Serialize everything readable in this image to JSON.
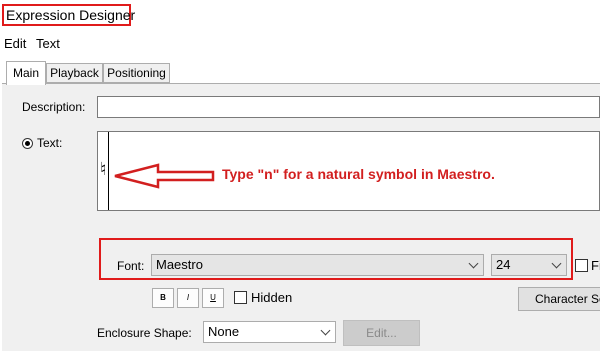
{
  "window": {
    "title": "Expression Designer"
  },
  "menu": {
    "edit": "Edit",
    "text": "Text"
  },
  "tabs": {
    "main": "Main",
    "playback": "Playback",
    "positioning": "Positioning"
  },
  "form": {
    "description_label": "Description:",
    "description_value": "",
    "text_label": "Text:",
    "text_content_glyph": "♮",
    "annotation": "Type \"n\" for a natural symbol in Maestro.",
    "font_label": "Font:",
    "font_value": "Maestro",
    "size_value": "24",
    "fixed_label": "Fi",
    "bold_label": "B",
    "italic_label": "I",
    "underline_label": "U",
    "hidden_label": "Hidden",
    "character_select_label": "Character Se",
    "enclosure_label": "Enclosure Shape:",
    "enclosure_value": "None",
    "enclosure_edit_label": "Edit..."
  },
  "colors": {
    "annotation_red": "#d21f1f",
    "panel_bg": "#f0f0f0"
  }
}
